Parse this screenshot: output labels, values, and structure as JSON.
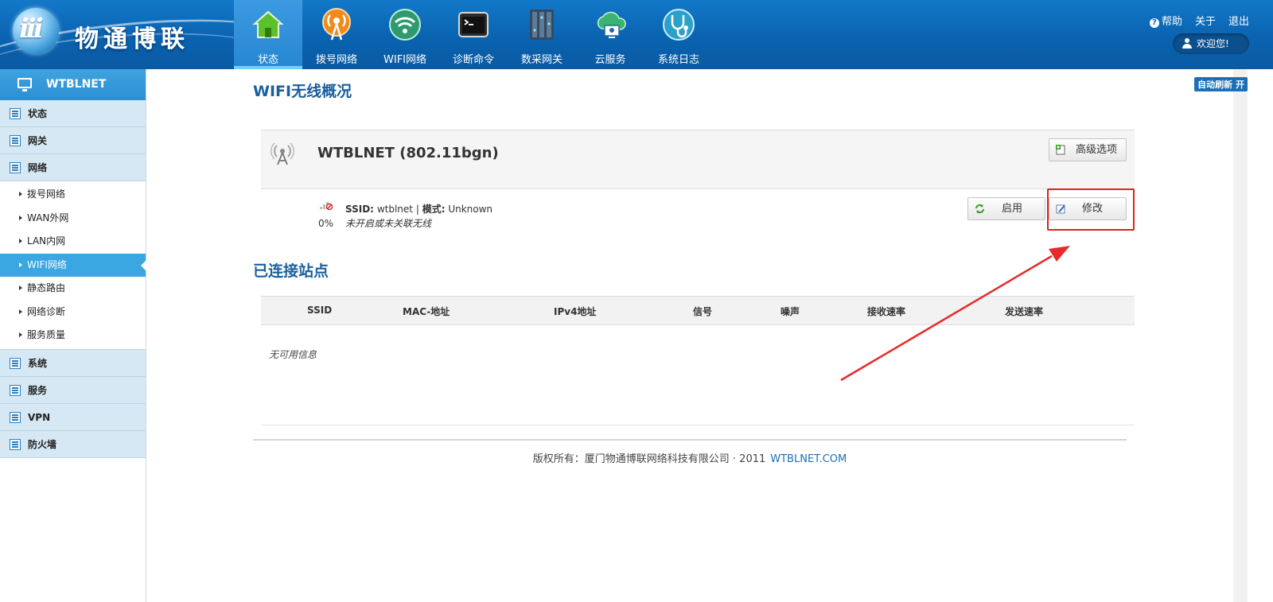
{
  "brand": {
    "logo_text": "iii",
    "name": "物通博联"
  },
  "topnav": [
    {
      "label": "状态",
      "icon": "house-icon",
      "active": true
    },
    {
      "label": "拨号网络",
      "icon": "broadcast-icon"
    },
    {
      "label": "WIFI网络",
      "icon": "wifi-icon"
    },
    {
      "label": "诊断命令",
      "icon": "terminal-icon"
    },
    {
      "label": "数采网关",
      "icon": "gateway-icon"
    },
    {
      "label": "云服务",
      "icon": "cloud-icon"
    },
    {
      "label": "系统日志",
      "icon": "stethoscope-icon"
    }
  ],
  "toplinks": {
    "help": "帮助",
    "about": "关于",
    "logout": "退出"
  },
  "welcome": "欢迎您!",
  "sidebar": {
    "title": "WTBLNET",
    "sections_top": [
      "状态",
      "网关",
      "网络"
    ],
    "network_items": [
      {
        "label": "拨号网络"
      },
      {
        "label": "WAN外网"
      },
      {
        "label": "LAN内网"
      },
      {
        "label": "WIFI网络",
        "active": true
      },
      {
        "label": "静态路由"
      },
      {
        "label": "网络诊断"
      },
      {
        "label": "服务质量"
      }
    ],
    "sections_bottom": [
      "系统",
      "服务",
      "VPN",
      "防火墙"
    ]
  },
  "auto_refresh": "自动刷新 开",
  "wifi_overview": {
    "title": "WIFI无线概况",
    "device_name": "WTBLNET (802.11bgn)",
    "advanced_button": "高级选项",
    "signal_percent": "0%",
    "ssid_label": "SSID:",
    "ssid_value": "wtblnet",
    "separator": "|",
    "mode_label": "模式:",
    "mode_value": "Unknown",
    "status_text": "未开启或未关联无线",
    "enable_button": "启用",
    "modify_button": "修改"
  },
  "stations": {
    "title": "已连接站点",
    "columns": [
      "SSID",
      "MAC-地址",
      "IPv4地址",
      "信号",
      "噪声",
      "接收速率",
      "发送速率"
    ],
    "empty_text": "无可用信息"
  },
  "footer": {
    "copyright": "版权所有：厦门物通博联网络科技有限公司 · 2011",
    "link": "WTBLNET.COM"
  },
  "colors": {
    "header_blue": "#0a63b0",
    "accent": "#3aa6e2",
    "title_blue": "#1a5f9e",
    "annotation_red": "#e02020"
  }
}
